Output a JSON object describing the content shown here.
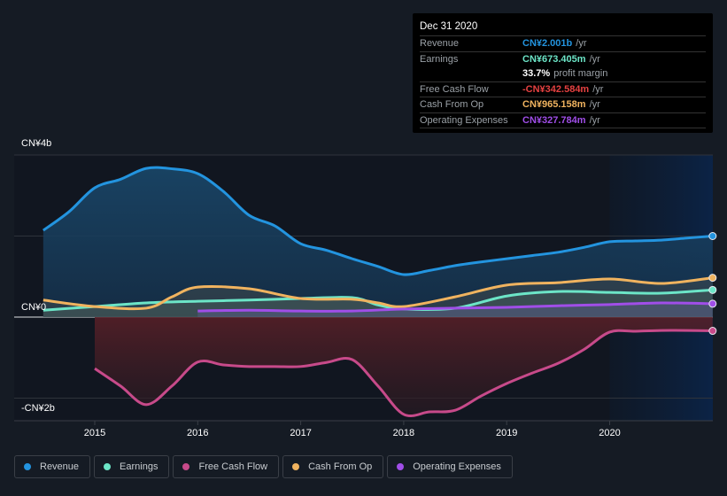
{
  "tooltip": {
    "date": "Dec 31 2020",
    "rows": [
      {
        "label": "Revenue",
        "value": "CN¥2.001b",
        "unit": "/yr",
        "color": "#2394df"
      },
      {
        "label": "Earnings",
        "value": "CN¥673.405m",
        "unit": "/yr",
        "color": "#6ce5c7"
      },
      {
        "label": "",
        "value": "33.7%",
        "unit": "profit margin",
        "color": "#ffffff"
      },
      {
        "label": "Free Cash Flow",
        "value": "-CN¥342.584m",
        "unit": "/yr",
        "color": "#e64141"
      },
      {
        "label": "Cash From Op",
        "value": "CN¥965.158m",
        "unit": "/yr",
        "color": "#f0b35f"
      },
      {
        "label": "Operating Expenses",
        "value": "CN¥327.784m",
        "unit": "/yr",
        "color": "#a04ee8"
      }
    ]
  },
  "legend": [
    {
      "label": "Revenue",
      "color": "#2394df"
    },
    {
      "label": "Earnings",
      "color": "#6ce5c7"
    },
    {
      "label": "Free Cash Flow",
      "color": "#c74a8a"
    },
    {
      "label": "Cash From Op",
      "color": "#f0b35f"
    },
    {
      "label": "Operating Expenses",
      "color": "#a04ee8"
    }
  ],
  "chart_data": {
    "type": "area",
    "title": "",
    "xlabel": "",
    "ylabel": "",
    "unit": "CN¥ billions",
    "ylim": [
      -2.6,
      4
    ],
    "xlim": [
      2014.0,
      2021.0
    ],
    "y_tick_labels": [
      {
        "value": 4,
        "label": "CN¥4b"
      },
      {
        "value": 0,
        "label": "CN¥0"
      },
      {
        "value": -2,
        "label": "-CN¥2b"
      }
    ],
    "x_tick_labels": [
      {
        "value": 2015,
        "label": "2015"
      },
      {
        "value": 2016,
        "label": "2016"
      },
      {
        "value": 2017,
        "label": "2017"
      },
      {
        "value": 2018,
        "label": "2018"
      },
      {
        "value": 2019,
        "label": "2019"
      },
      {
        "value": 2020,
        "label": "2020"
      }
    ],
    "gridlines": [
      4,
      2,
      0,
      -2
    ],
    "highlight_from": 2020.0,
    "legend_position": "bottom-left",
    "series": [
      {
        "name": "Revenue",
        "color": "#2394df",
        "x": [
          2014.5,
          2014.75,
          2015,
          2015.25,
          2015.5,
          2015.75,
          2016,
          2016.25,
          2016.5,
          2016.75,
          2017,
          2017.25,
          2017.5,
          2017.75,
          2018,
          2018.25,
          2018.5,
          2018.75,
          2019,
          2019.25,
          2019.5,
          2019.75,
          2020,
          2020.25,
          2020.5,
          2020.75,
          2021
        ],
        "values": [
          2.14,
          2.6,
          3.19,
          3.4,
          3.67,
          3.66,
          3.54,
          3.1,
          2.51,
          2.25,
          1.81,
          1.65,
          1.44,
          1.25,
          1.05,
          1.15,
          1.27,
          1.36,
          1.44,
          1.52,
          1.6,
          1.72,
          1.86,
          1.88,
          1.9,
          1.95,
          2.0
        ]
      },
      {
        "name": "Earnings",
        "color": "#6ce5c7",
        "x": [
          2014.5,
          2015,
          2015.5,
          2016,
          2016.5,
          2017,
          2017.5,
          2017.75,
          2018,
          2018.5,
          2019,
          2019.5,
          2020,
          2020.5,
          2021
        ],
        "values": [
          0.17,
          0.26,
          0.35,
          0.39,
          0.42,
          0.46,
          0.48,
          0.3,
          0.2,
          0.22,
          0.52,
          0.63,
          0.61,
          0.59,
          0.67
        ]
      },
      {
        "name": "Free Cash Flow",
        "color": "#c74a8a",
        "x": [
          2015,
          2015.25,
          2015.5,
          2015.75,
          2016,
          2016.25,
          2016.5,
          2016.75,
          2017,
          2017.25,
          2017.5,
          2017.75,
          2018,
          2018.25,
          2018.5,
          2018.75,
          2019,
          2019.25,
          2019.5,
          2019.75,
          2020,
          2020.25,
          2020.5,
          2020.75,
          2021
        ],
        "values": [
          -1.27,
          -1.7,
          -2.16,
          -1.7,
          -1.11,
          -1.18,
          -1.22,
          -1.22,
          -1.22,
          -1.12,
          -1.05,
          -1.7,
          -2.4,
          -2.34,
          -2.3,
          -1.95,
          -1.64,
          -1.38,
          -1.14,
          -0.8,
          -0.37,
          -0.35,
          -0.33,
          -0.33,
          -0.34
        ]
      },
      {
        "name": "Cash From Op",
        "color": "#f0b35f",
        "x": [
          2014.5,
          2015,
          2015.5,
          2015.75,
          2016,
          2016.5,
          2017,
          2017.5,
          2017.75,
          2018,
          2018.5,
          2019,
          2019.5,
          2020,
          2020.5,
          2021
        ],
        "values": [
          0.42,
          0.26,
          0.22,
          0.5,
          0.74,
          0.7,
          0.46,
          0.44,
          0.35,
          0.26,
          0.5,
          0.79,
          0.85,
          0.94,
          0.83,
          0.97
        ]
      },
      {
        "name": "Operating Expenses",
        "color": "#a04ee8",
        "x": [
          2016,
          2016.5,
          2017,
          2017.5,
          2018,
          2018.5,
          2019,
          2019.5,
          2020,
          2020.5,
          2021
        ],
        "values": [
          0.15,
          0.17,
          0.15,
          0.15,
          0.2,
          0.22,
          0.24,
          0.28,
          0.31,
          0.35,
          0.33
        ]
      }
    ]
  }
}
